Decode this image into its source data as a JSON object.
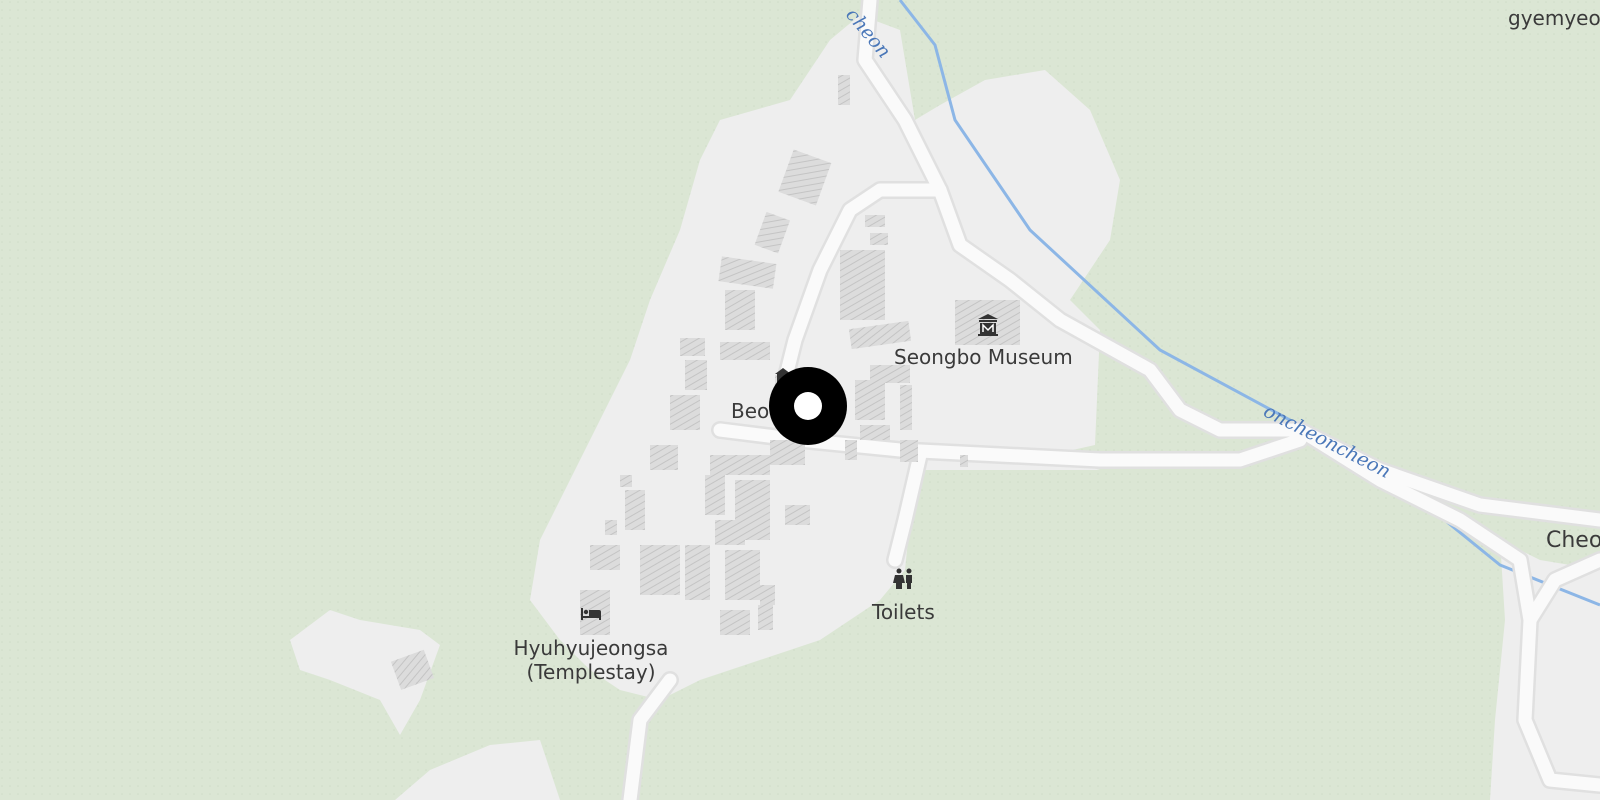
{
  "map": {
    "colors": {
      "forest": "#dbe6d4",
      "developed": "#eeeeee",
      "road": "#fafafa",
      "road_casing": "#e2e2e2",
      "water": "#8cb6e6",
      "water_label": "#4a77b8",
      "building_hatch": "#d4d4d4",
      "label": "#3a3a3a",
      "marker": "#000000"
    },
    "labels": {
      "top_right": "gyemyeo",
      "seongbo_museum": "Seongbo Museum",
      "temple_partial": "Beo",
      "toilets": "Toilets",
      "templestay_line1": "Hyuhyujeongsa",
      "templestay_line2": "(Templestay)",
      "right_edge": "Cheo",
      "stream_top": "cheon",
      "stream_right": "oncheoncheon"
    },
    "icons": {
      "museum": "museum-icon",
      "toilets": "toilets-icon",
      "templestay": "lodging-icon",
      "temple": "temple-icon",
      "marker": "location-marker"
    }
  }
}
